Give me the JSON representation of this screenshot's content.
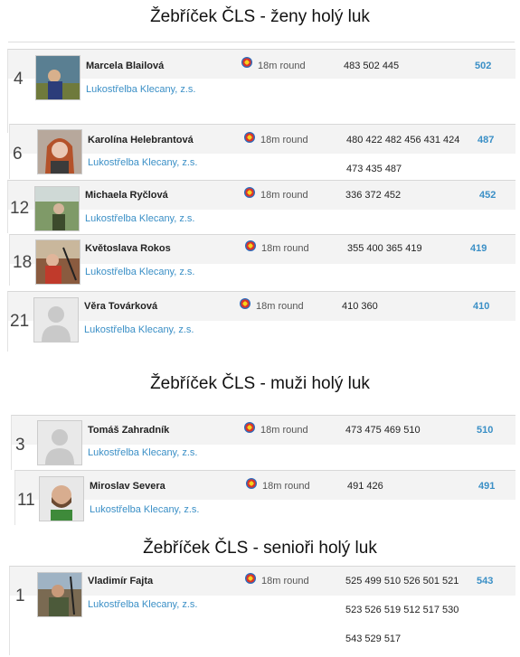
{
  "sections": [
    {
      "title": "Žebříček ČLS - ženy holý luk"
    },
    {
      "title": "Žebříček ČLS - muži holý luk"
    },
    {
      "title": "Žebříček ČLS - senioři holý luk"
    }
  ],
  "archers": [
    {
      "rank": "4",
      "name": "Marcela Blailová",
      "club": "Lukostřelba Klecany, z.s.",
      "round": "18m round",
      "scores": [
        "483 502 445"
      ],
      "total": "502"
    },
    {
      "rank": "6",
      "name": "Karolína Helebrantová",
      "club": "Lukostřelba Klecany, z.s.",
      "round": "18m round",
      "scores": [
        "480 422 482 456 431 424",
        "473 435 487"
      ],
      "total": "487"
    },
    {
      "rank": "12",
      "name": "Michaela Ryčlová",
      "club": "Lukostřelba Klecany, z.s.",
      "round": "18m round",
      "scores": [
        "336 372 452"
      ],
      "total": "452"
    },
    {
      "rank": "18",
      "name": "Květoslava Rokos",
      "club": "Lukostřelba Klecany, z.s.",
      "round": "18m round",
      "scores": [
        "355 400 365 419"
      ],
      "total": "419"
    },
    {
      "rank": "21",
      "name": "Věra Továrková",
      "club": "Lukostřelba Klecany, z.s.",
      "round": "18m round",
      "scores": [
        "410 360"
      ],
      "total": "410"
    },
    {
      "rank": "3",
      "name": "Tomáš Zahradník",
      "club": "Lukostřelba Klecany, z.s.",
      "round": "18m round",
      "scores": [
        "473 475 469 510"
      ],
      "total": "510"
    },
    {
      "rank": "11",
      "name": "Miroslav Severa",
      "club": "Lukostřelba Klecany, z.s.",
      "round": "18m round",
      "scores": [
        "491 426"
      ],
      "total": "491"
    },
    {
      "rank": "1",
      "name": "Vladimír Fajta",
      "club": "Lukostřelba Klecany, z.s.",
      "round": "18m round",
      "scores": [
        "525 499 510 526 501 521",
        "523 526 519 512 517 530",
        "543 529 517"
      ],
      "total": "543"
    }
  ],
  "icons": {
    "round": "target-icon",
    "placeholder": "user-placeholder-icon"
  },
  "colors": {
    "link": "#3a8fc6",
    "row_band": "#f3f3f3"
  }
}
